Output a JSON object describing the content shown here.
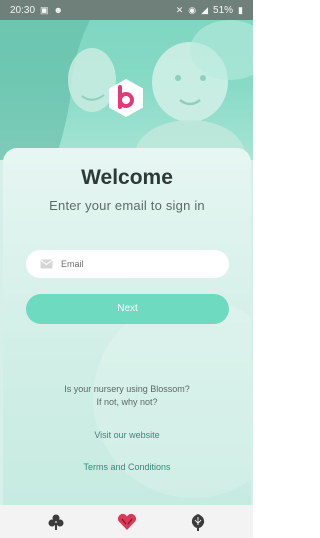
{
  "status_bar": {
    "time": "20:30",
    "battery": "51%",
    "icons": [
      "image-icon",
      "user-icon",
      "mute-icon",
      "wifi-icon",
      "signal-icon",
      "battery-icon"
    ]
  },
  "brand": {
    "logo_letter": "b",
    "accent": "#e5387a",
    "primary": "#6edbc1"
  },
  "login": {
    "title": "Welcome",
    "subtitle": "Enter your email to sign in",
    "email_placeholder": "Email",
    "next_label": "Next"
  },
  "info": {
    "line1": "Is your nursery using Blossom?",
    "line2": "If not, why not?"
  },
  "links": {
    "website": "Visit our website",
    "terms": "Terms and Conditions"
  },
  "bottom_nav": {
    "items": [
      "recent-apps-icon",
      "home-icon",
      "back-icon"
    ]
  }
}
